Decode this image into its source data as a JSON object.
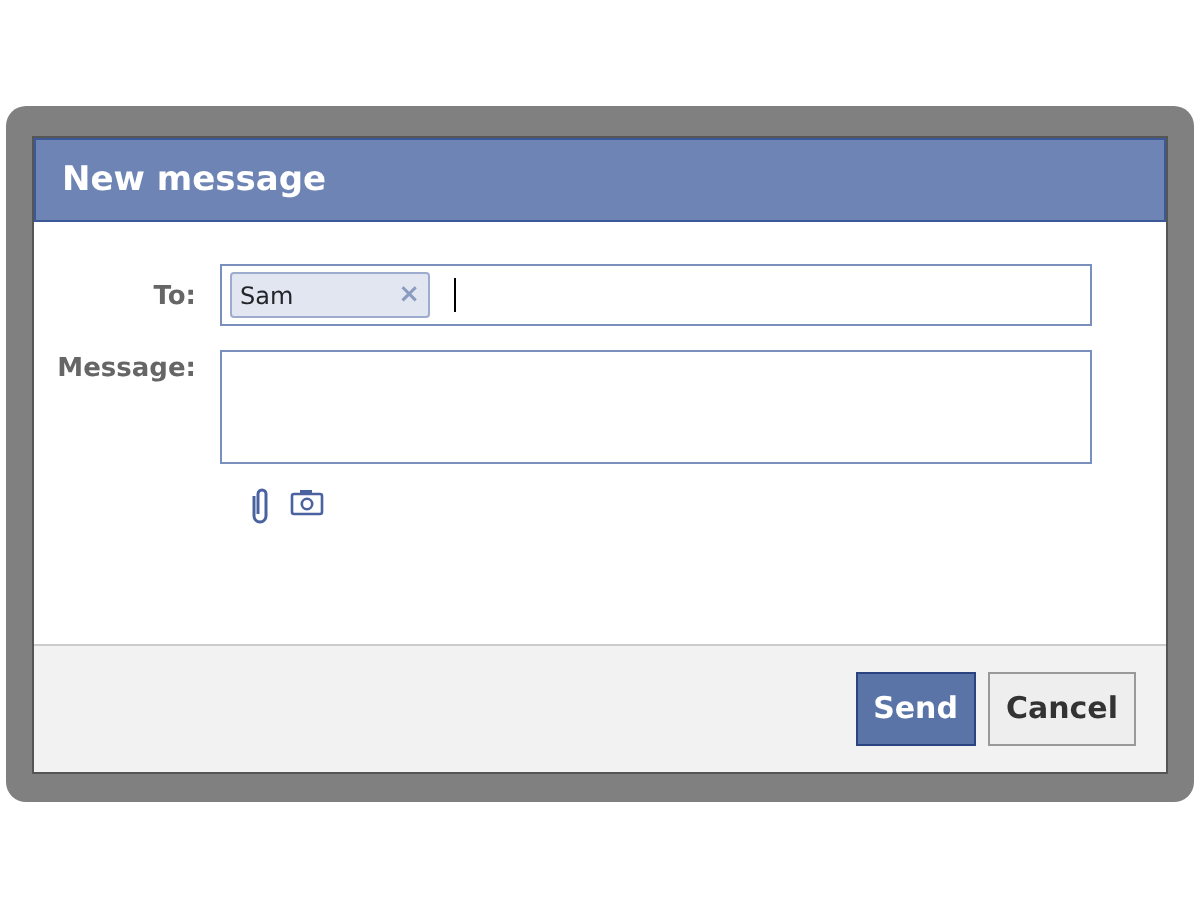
{
  "dialog": {
    "title": "New message"
  },
  "to": {
    "label": "To:",
    "recipients": [
      {
        "name": "Sam",
        "remove": "×"
      }
    ]
  },
  "message": {
    "label": "Message:"
  },
  "buttons": [
    {
      "label": "Send",
      "kind": "primary"
    },
    {
      "label": "Cancel",
      "kind": "secondary"
    }
  ]
}
